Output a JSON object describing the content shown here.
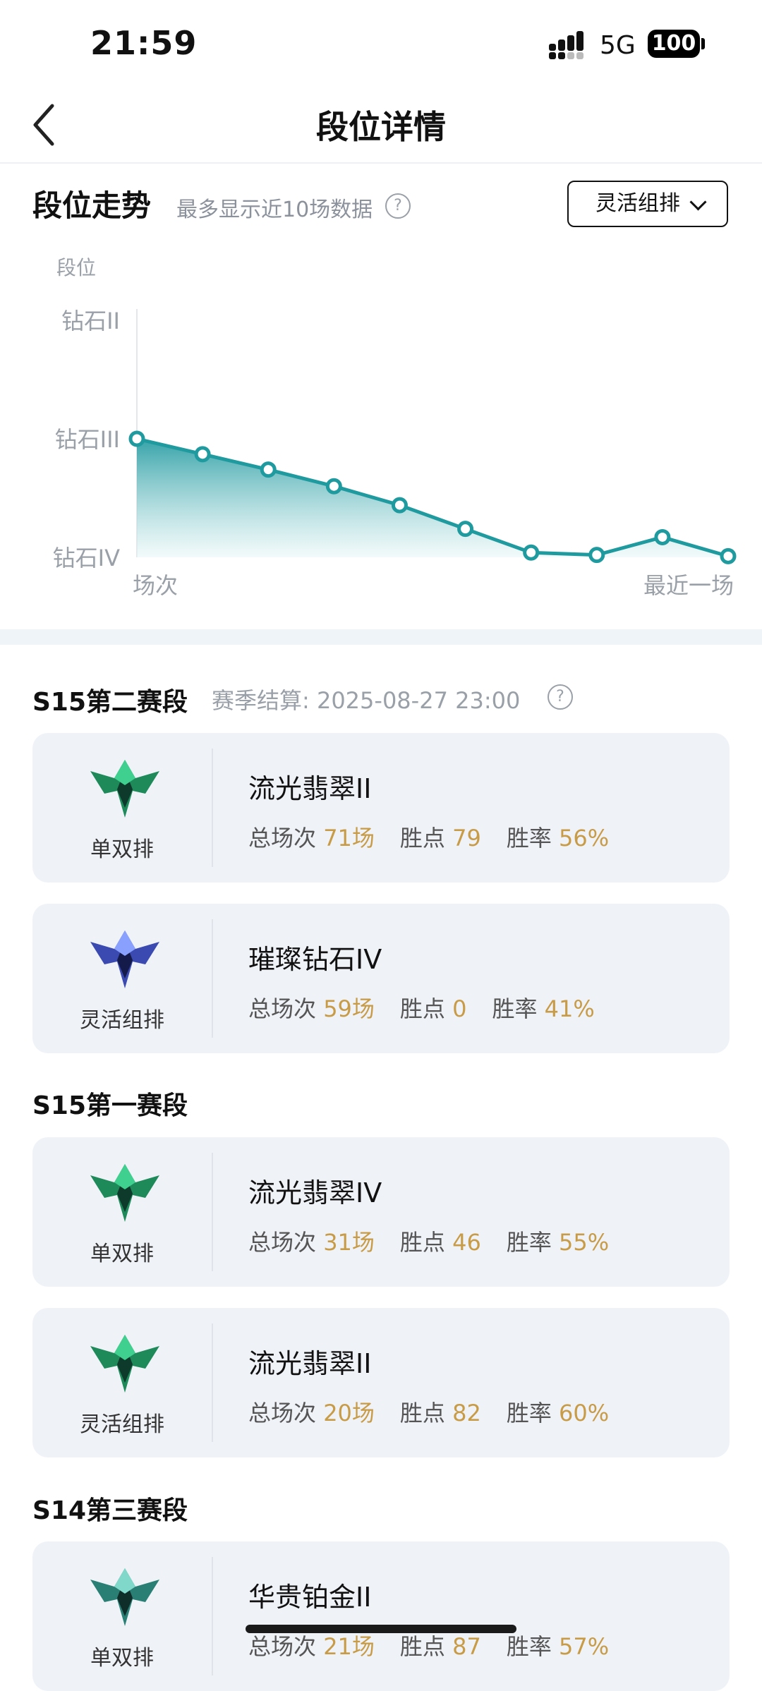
{
  "status_bar": {
    "time": "21:59",
    "network": "5G",
    "battery": "100"
  },
  "nav": {
    "title": "段位详情"
  },
  "trend": {
    "title": "段位走势",
    "hint": "最多显示近10场数据",
    "mode_selected": "灵活组排",
    "y_axis_label": "段位",
    "x_start_label": "场次",
    "x_end_label": "最近一场"
  },
  "chart_data": {
    "type": "area",
    "ylabel": "段位",
    "xlabel": "场次",
    "y_ticks": [
      "钻石II",
      "钻石III",
      "钻石IV"
    ],
    "y_tick_values": [
      2,
      1,
      0
    ],
    "ylim": [
      0,
      2
    ],
    "x": [
      1,
      2,
      3,
      4,
      5,
      6,
      7,
      8,
      9,
      10
    ],
    "values": [
      1.0,
      0.87,
      0.74,
      0.6,
      0.44,
      0.24,
      0.04,
      0.02,
      0.17,
      0.01
    ],
    "colors": {
      "line": "#1f9a9f",
      "fill_top": "#2a9ea4",
      "fill_bottom": "#eef8f9"
    }
  },
  "seasons": [
    {
      "title": "S15第二赛段",
      "settlement": "赛季结算: 2025-08-27 23:00",
      "cards": [
        {
          "queue": "单双排",
          "rank": "流光翡翠II",
          "total_label": "总场次",
          "total": "71场",
          "lp_label": "胜点",
          "lp": "79",
          "wr_label": "胜率",
          "wr": "56%",
          "emblem": "emerald"
        },
        {
          "queue": "灵活组排",
          "rank": "璀璨钻石IV",
          "total_label": "总场次",
          "total": "59场",
          "lp_label": "胜点",
          "lp": "0",
          "wr_label": "胜率",
          "wr": "41%",
          "emblem": "diamond"
        }
      ]
    },
    {
      "title": "S15第一赛段",
      "cards": [
        {
          "queue": "单双排",
          "rank": "流光翡翠IV",
          "total_label": "总场次",
          "total": "31场",
          "lp_label": "胜点",
          "lp": "46",
          "wr_label": "胜率",
          "wr": "55%",
          "emblem": "emerald"
        },
        {
          "queue": "灵活组排",
          "rank": "流光翡翠II",
          "total_label": "总场次",
          "total": "20场",
          "lp_label": "胜点",
          "lp": "82",
          "wr_label": "胜率",
          "wr": "60%",
          "emblem": "emerald"
        }
      ]
    },
    {
      "title": "S14第三赛段",
      "cards": [
        {
          "queue": "单双排",
          "rank": "华贵铂金II",
          "total_label": "总场次",
          "total": "21场",
          "lp_label": "胜点",
          "lp": "87",
          "wr_label": "胜率",
          "wr": "57%",
          "emblem": "platinum"
        }
      ]
    }
  ]
}
